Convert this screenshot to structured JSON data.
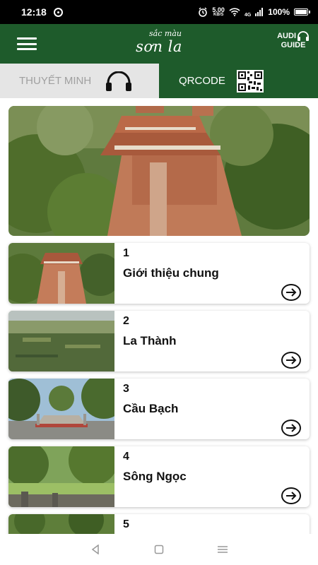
{
  "status_bar": {
    "time": "12:18",
    "net_speed_value": "5.00",
    "net_speed_unit": "KB/S",
    "network_type": "4G",
    "battery": "100%"
  },
  "header": {
    "brand_small": "sắc màu",
    "brand_big": "sơn la",
    "audio_top": "AUDI",
    "audio_bottom": "GUIDE"
  },
  "tabs": {
    "narration_label": "THUYẾT MINH",
    "qr_label": "QRCODE"
  },
  "colors": {
    "primary_green": "#1e5b2b",
    "tab_inactive_bg": "#e5e5e5"
  },
  "sites": [
    {
      "number": "1",
      "title": "Giới thiệu chung",
      "thumb": "temple-aerial"
    },
    {
      "number": "2",
      "title": "La Thành",
      "thumb": "forest-aerial"
    },
    {
      "number": "3",
      "title": "Cầu Bạch",
      "thumb": "stone-bridge"
    },
    {
      "number": "4",
      "title": "Sông Ngọc",
      "thumb": "river-park"
    },
    {
      "number": "5",
      "title": "",
      "thumb": "trees"
    }
  ],
  "icons": {
    "menu": "hamburger-icon",
    "headphones": "headphones-icon",
    "qr": "qr-code-icon",
    "arrow": "arrow-right-circle-icon",
    "nav_back": "back-triangle-icon",
    "nav_home": "home-square-icon",
    "nav_recents": "recents-lines-icon"
  }
}
